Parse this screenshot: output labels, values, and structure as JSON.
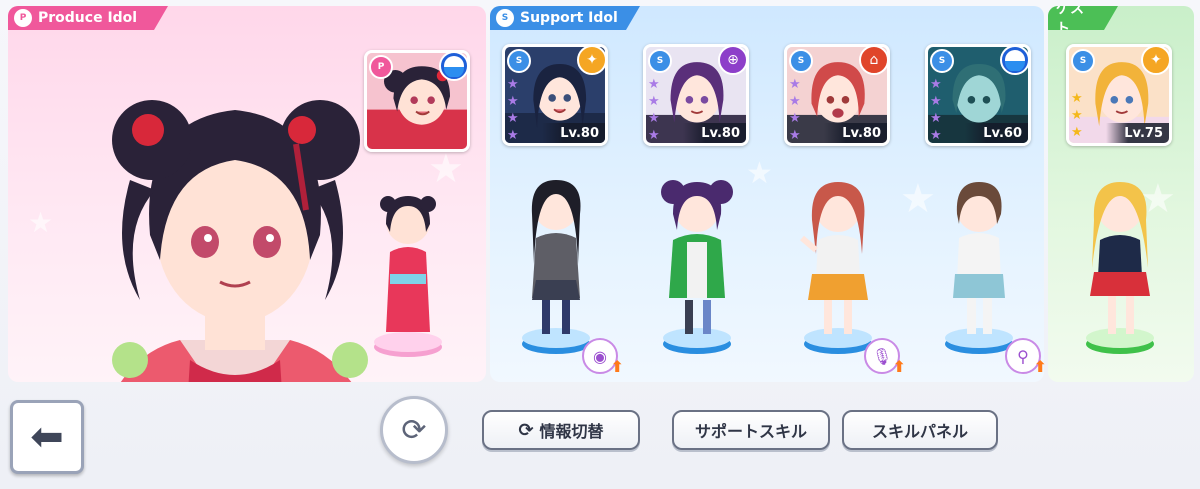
{
  "produce_panel": {
    "tab_badge": "P",
    "tab_label": "Produce Idol"
  },
  "support_panel": {
    "tab_badge": "S",
    "tab_label": "Support Idol"
  },
  "guest_panel": {
    "tab_label": "ゲスト"
  },
  "produce_card": {
    "type_badge": "P",
    "attribute": "blue-orb-icon"
  },
  "support_cards": [
    {
      "type_badge": "S",
      "attribute": "star-burst-icon",
      "rarity_stars": 4,
      "level": "Lv.80"
    },
    {
      "type_badge": "S",
      "attribute": "target-icon",
      "rarity_stars": 4,
      "level": "Lv.80"
    },
    {
      "type_badge": "S",
      "attribute": "school-icon",
      "rarity_stars": 4,
      "level": "Lv.80"
    },
    {
      "type_badge": "S",
      "attribute": "blue-orb-icon",
      "rarity_stars": 4,
      "level": "Lv.60"
    }
  ],
  "guest_card": {
    "type_badge": "S",
    "attribute": "star-burst-icon",
    "rarity_stars": 3,
    "level": "Lv.75"
  },
  "skill_badges": [
    "speaker-icon",
    "microphone-icon",
    "hand-mirror-icon"
  ],
  "controls": {
    "info_switch": "情報切替",
    "support_skill": "サポートスキル",
    "skill_panel": "スキルパネル"
  },
  "colors": {
    "produce_accent": "#f0589b",
    "support_accent": "#3b8fe6",
    "guest_accent": "#4cbf56",
    "star_purple": "#a97be6",
    "star_gold": "#f4b81c",
    "upgrade_orange": "#ff7a1a"
  }
}
